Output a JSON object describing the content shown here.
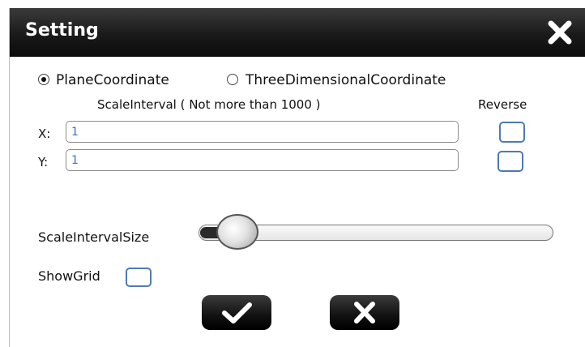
{
  "dialog": {
    "title": "Setting",
    "icons": {
      "close": "close-x-icon",
      "confirm": "check-icon",
      "cancel": "cancel-x-icon"
    }
  },
  "coordinate_options": [
    {
      "label": "PlaneCoordinate",
      "checked": true
    },
    {
      "label": "ThreeDimensionalCoordinate",
      "checked": false
    }
  ],
  "scale_interval": {
    "header": "ScaleInterval ( Not more than 1000 )",
    "reverse_header": "Reverse",
    "x": {
      "label": "X:",
      "value": "1",
      "reverse_checked": false
    },
    "y": {
      "label": "Y:",
      "value": "1",
      "reverse_checked": false
    }
  },
  "scale_interval_size": {
    "label": "ScaleIntervalSize",
    "level_fraction": 0.07
  },
  "show_grid": {
    "label": "ShowGrid",
    "checked": false
  },
  "colors": {
    "titlebar": "#111111",
    "checkbox_border": "#4f78b8",
    "input_text": "#3a6fd8"
  }
}
